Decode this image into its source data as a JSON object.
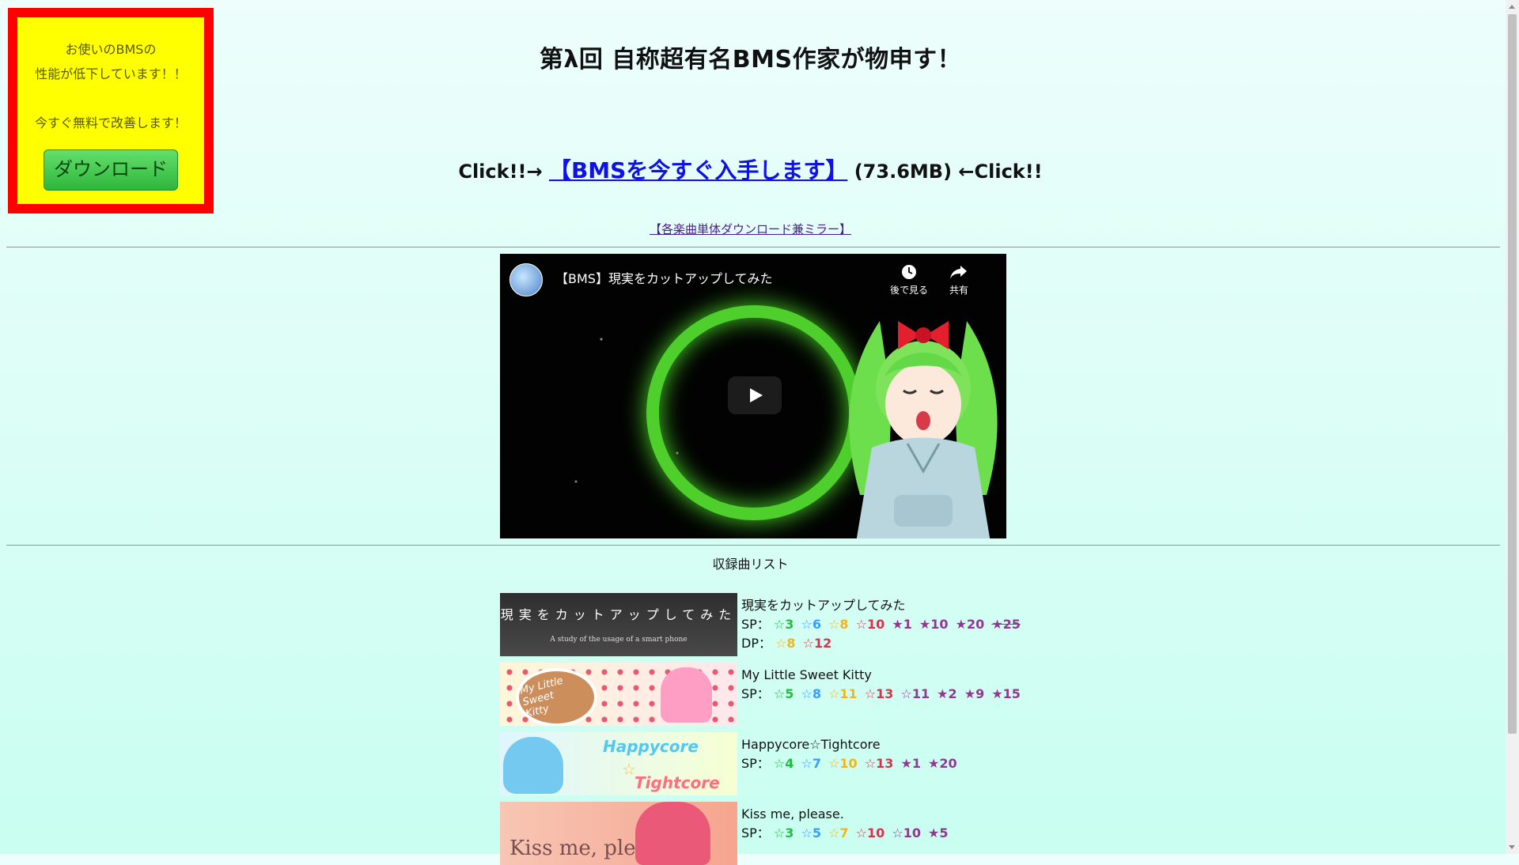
{
  "ad": {
    "line1": "お使いのBMSの",
    "line2": "性能が低下しています！！",
    "line3": "今すぐ無料で改善します！",
    "download_label": "ダウンロード"
  },
  "header": {
    "title": "第λ回 自称超有名BMS作家が物申す！"
  },
  "download_line": {
    "prefix": "Click!!→",
    "link_text": "【BMSを今すぐ入手します】",
    "size": "(73.6MB)",
    "suffix": "←Click!!"
  },
  "mirror_link": "【各楽曲単体ダウンロード兼ミラー】",
  "video": {
    "title": "【BMS】現実をカットアップしてみた",
    "watch_later": "後で見る",
    "share": "共有"
  },
  "list_header": "収録曲リスト",
  "songs": [
    {
      "title": "現実をカットアップしてみた",
      "banner_text": "現実をカットアップしてみた",
      "banner_sub": "A study of the usage of a smart phone",
      "sp_label": "SP：",
      "sp": [
        "☆3",
        "☆6",
        "☆8",
        "☆10",
        "★1",
        "★10",
        "★20",
        "★25"
      ],
      "dp_label": "DP：",
      "dp": [
        "☆8",
        "☆12"
      ]
    },
    {
      "title": "My Little Sweet Kitty",
      "banner_text": "My Little Sweet Kitty",
      "sp_label": "SP：",
      "sp": [
        "☆5",
        "☆8",
        "☆11",
        "☆13",
        "☆11",
        "★2",
        "★9",
        "★15"
      ]
    },
    {
      "title": "Happycore☆Tightcore",
      "banner_text_1": "Happycore",
      "banner_text_2": "Tightcore",
      "sp_label": "SP：",
      "sp": [
        "☆4",
        "☆7",
        "☆10",
        "☆13",
        "★1",
        "★20"
      ]
    },
    {
      "title": "Kiss me, please.",
      "banner_text": "Kiss me, please",
      "sp_label": "SP：",
      "sp": [
        "☆3",
        "☆5",
        "☆7",
        "☆10",
        "☆10",
        "★5"
      ]
    }
  ],
  "colors": {
    "accent_link": "#1010e8",
    "ad_background": "#ffff00",
    "ad_border": "#ff0000",
    "download_button": "#2fb63b"
  }
}
